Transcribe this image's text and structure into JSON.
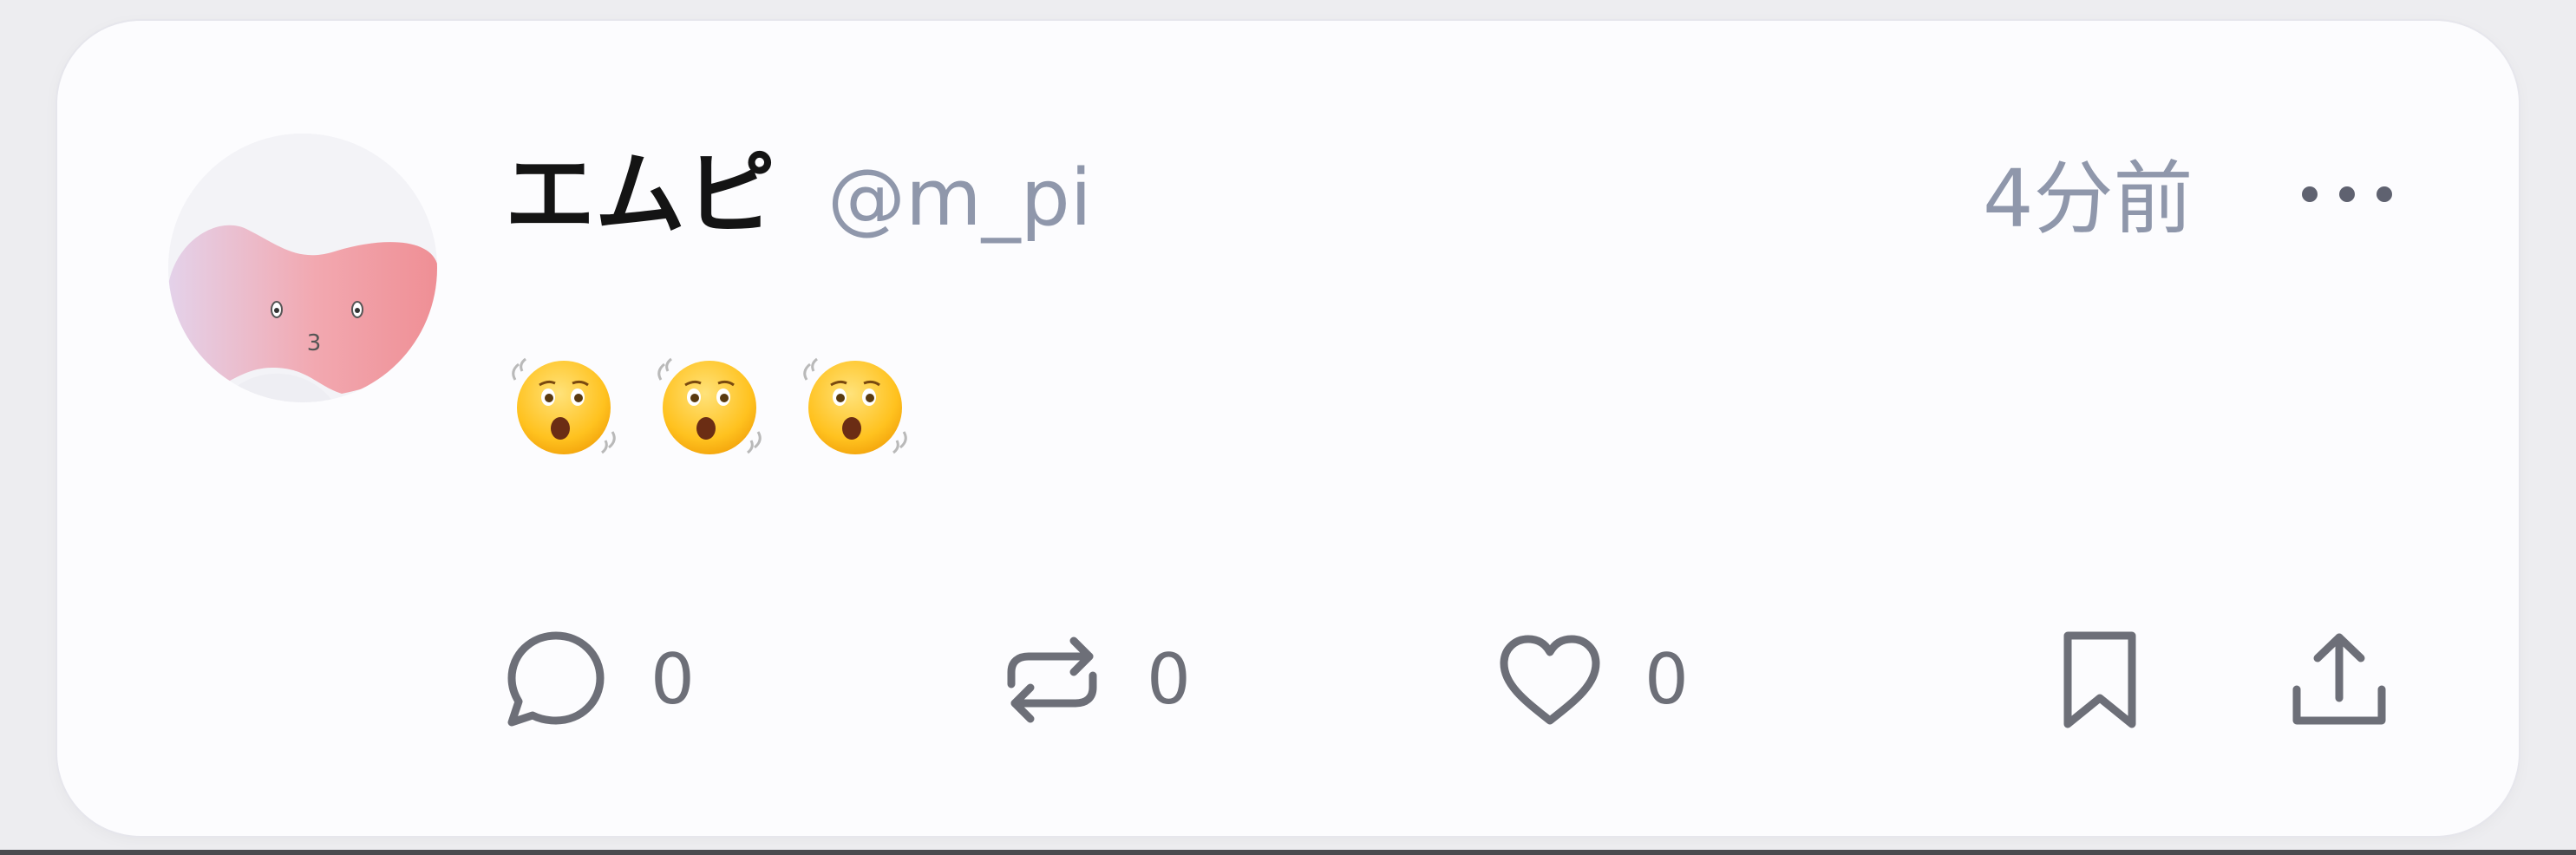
{
  "post": {
    "author": {
      "display_name": "エムピ",
      "handle": "@m_pi",
      "avatar_icon": "cartoon-face-avatar"
    },
    "timestamp": "4分前",
    "body": {
      "emojis": [
        "😯",
        "😯",
        "😯"
      ]
    },
    "actions": {
      "reply_count": "0",
      "repost_count": "0",
      "like_count": "0"
    }
  },
  "colors": {
    "muted_text": "#8f97ab",
    "icon_gray": "#6d6f78",
    "card_bg": "#fcfcfe",
    "avatar_pink": "#ef9a9e",
    "avatar_lavender": "#e2cfe8"
  }
}
